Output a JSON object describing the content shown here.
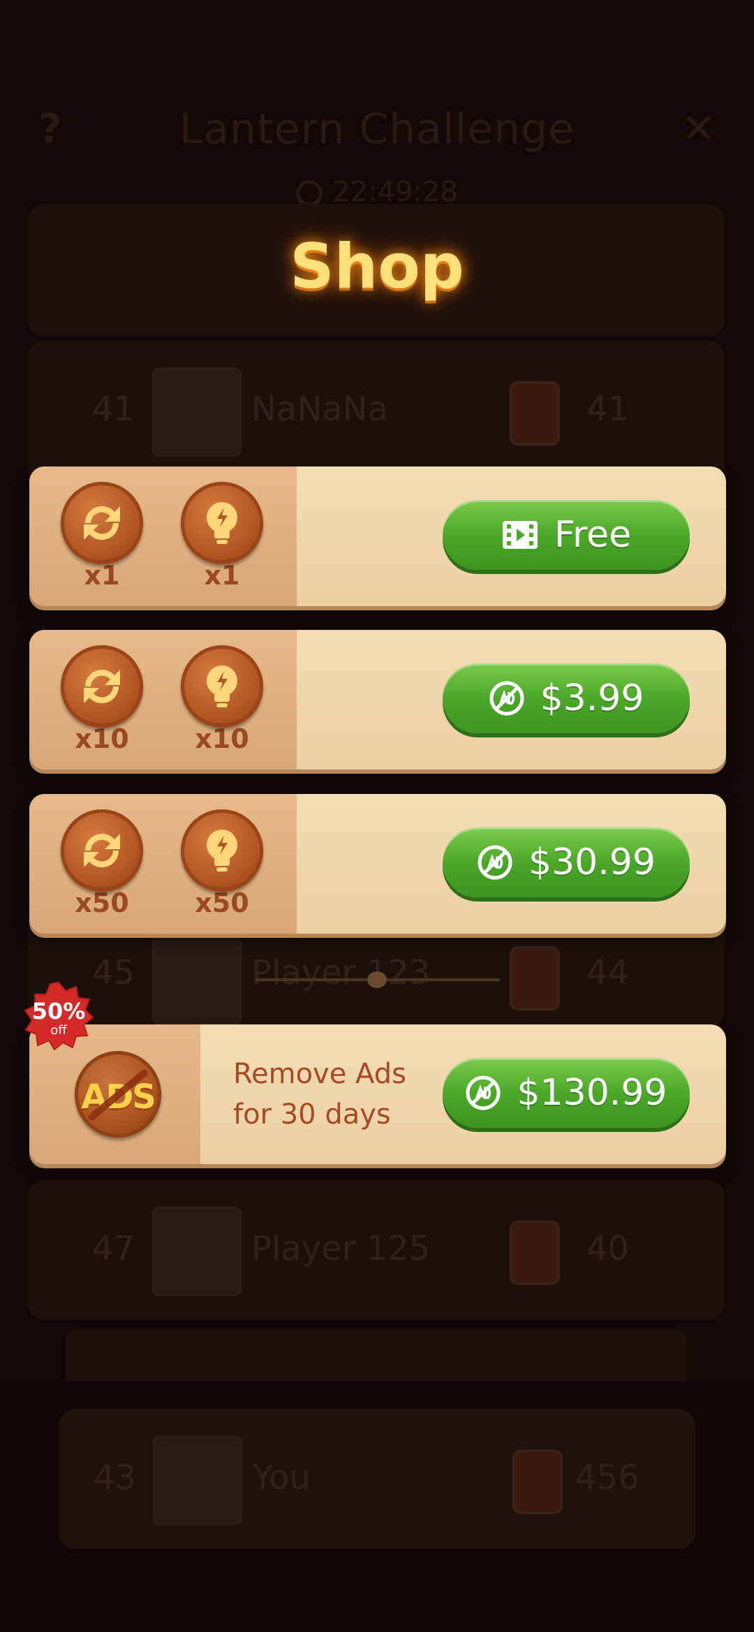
{
  "background": {
    "help_icon": "?",
    "title": "Lantern Challenge",
    "close_icon": "✕",
    "timer": "22:49:28",
    "rows": [
      {
        "rank": "41",
        "name": "NaNaNa",
        "score": "41"
      },
      {
        "rank": "45",
        "name": "Player 123",
        "score": "44"
      },
      {
        "rank": "47",
        "name": "Player 125",
        "score": "40"
      },
      {
        "rank": "43",
        "name": "You",
        "score": "456"
      }
    ]
  },
  "shop": {
    "title": "Shop",
    "packs": [
      {
        "shuffle_qty": "x1",
        "hint_qty": "x1",
        "price": "Free",
        "button_icon": "video-icon"
      },
      {
        "shuffle_qty": "x10",
        "hint_qty": "x10",
        "price": "$3.99",
        "button_icon": "no-ads-icon"
      },
      {
        "shuffle_qty": "x50",
        "hint_qty": "x50",
        "price": "$30.99",
        "button_icon": "no-ads-icon"
      }
    ],
    "remove_ads": {
      "badge_text": "ADS",
      "discount_pct": "50%",
      "discount_off": "off",
      "line1": "Remove Ads",
      "line2": "for 30 days",
      "price": "$130.99"
    }
  },
  "colors": {
    "button_green": "#4ba828",
    "card_bg": "#f4dcb4",
    "card_left": "#e6b98a",
    "title_glow": "#ffe07a",
    "discount_red": "#d42a2a"
  }
}
